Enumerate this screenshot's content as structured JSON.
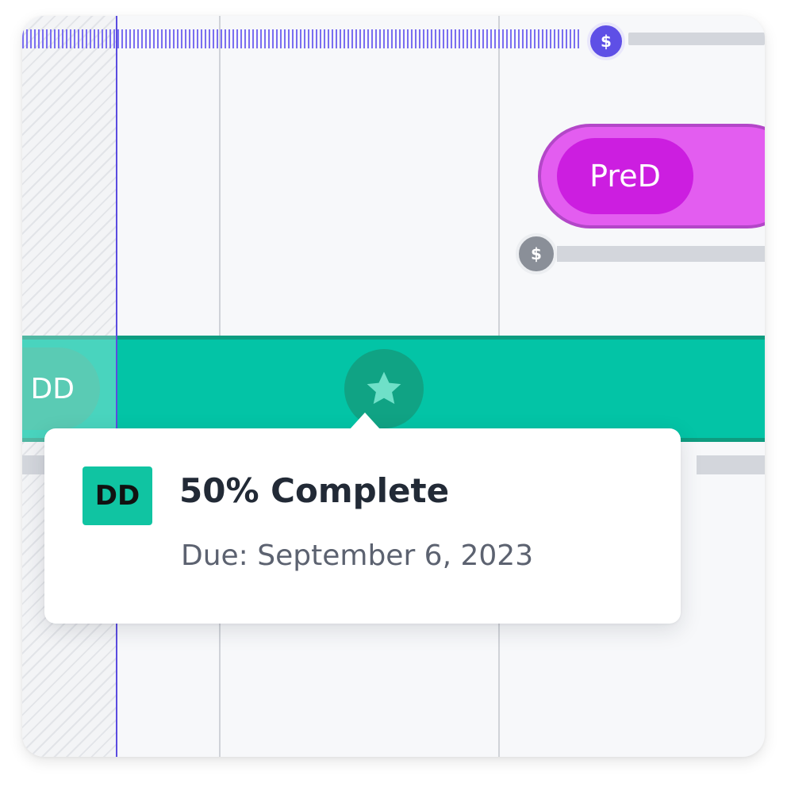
{
  "timeline": {
    "top_budget": {
      "currency_symbol": "$"
    },
    "pred_phase": {
      "label": "PreD",
      "color": "#cc1ee0",
      "budget_currency_symbol": "$"
    },
    "dd_phase": {
      "label": "DD",
      "color": "#03c4a6",
      "milestone_icon": "star-icon"
    }
  },
  "tooltip": {
    "badge": "DD",
    "title": "50% Complete",
    "due": "Due: September 6, 2023"
  }
}
